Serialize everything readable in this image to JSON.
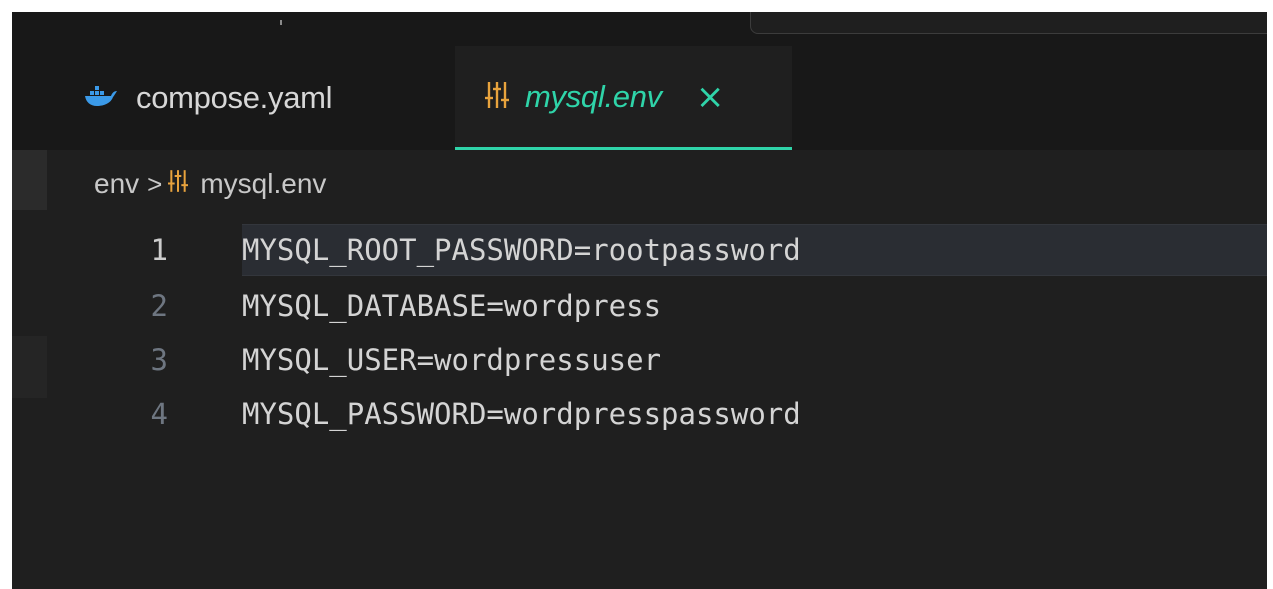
{
  "tabs": [
    {
      "label": "compose.yaml",
      "icon": "docker-whale-icon",
      "active": false
    },
    {
      "label": "mysql.env",
      "icon": "env-settings-icon",
      "active": true,
      "close": "×"
    }
  ],
  "breadcrumb": {
    "folder": "env",
    "separator": ">",
    "file": "mysql.env",
    "file_icon": "env-settings-icon"
  },
  "editor": {
    "active_line": 1,
    "lines": [
      {
        "number": "1",
        "text": "MYSQL_ROOT_PASSWORD=rootpassword"
      },
      {
        "number": "2",
        "text": "MYSQL_DATABASE=wordpress"
      },
      {
        "number": "3",
        "text": "MYSQL_USER=wordpressuser"
      },
      {
        "number": "4",
        "text": "MYSQL_PASSWORD=wordpresspassword"
      }
    ]
  },
  "colors": {
    "accent": "#2fd4a9",
    "env_icon": "#e8a33d",
    "docker_icon": "#3b9ae8",
    "background": "#1f1f1f"
  }
}
